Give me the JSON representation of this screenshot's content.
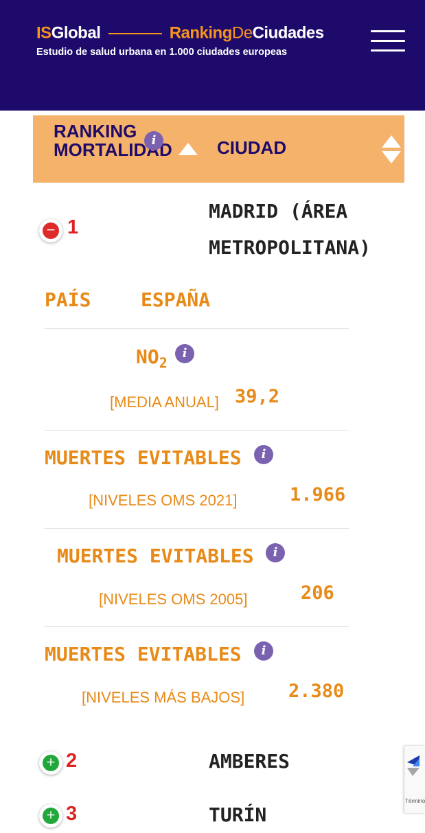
{
  "header": {
    "logo_is": "IS",
    "logo_global": "Global",
    "logo_ranking": "Ranking",
    "logo_de": "De",
    "logo_ciudades": "Ciudades",
    "subtitle": "Estudio de salud urbana en 1.000 ciudades europeas",
    "menu_icon": "hamburger-menu-icon"
  },
  "table_header": {
    "rank_line1": "RANKING",
    "rank_line2": "MORTALIDAD",
    "city": "CIUDAD",
    "info_glyph": "i"
  },
  "rows": [
    {
      "rank": "1",
      "city_line1": "MADRID (ÁREA",
      "city_line2": "METROPOLITANA)",
      "toggle": "−",
      "expanded": true
    },
    {
      "rank": "2",
      "city": "AMBERES",
      "toggle": "+"
    },
    {
      "rank": "3",
      "city": "TURÍN",
      "toggle": "+"
    }
  ],
  "details": {
    "pais_label": "PAÍS",
    "pais_value": "ESPAÑA",
    "no2_label": "NO",
    "no2_sub": "2",
    "no2_qualifier": "[MEDIA ANUAL]",
    "no2_value": "39,2",
    "deaths": [
      {
        "label": "MUERTES EVITABLES",
        "qualifier": "[NIVELES OMS 2021]",
        "value": "1.966"
      },
      {
        "label": "MUERTES EVITABLES",
        "qualifier": "[NIVELES OMS 2005]",
        "value": "206"
      },
      {
        "label": "MUERTES EVITABLES",
        "qualifier": "[NIVELES MÁS BAJOS]",
        "value": "2.380"
      }
    ]
  },
  "recaptcha": {
    "terms": "Términos"
  },
  "colors": {
    "header_bg": "#1e0a6b",
    "accent_orange": "#f5931e",
    "table_header_bg": "#f4b26a",
    "detail_orange": "#e88a17",
    "rank_red": "#dd2222",
    "info_purple": "#7b62b0"
  }
}
